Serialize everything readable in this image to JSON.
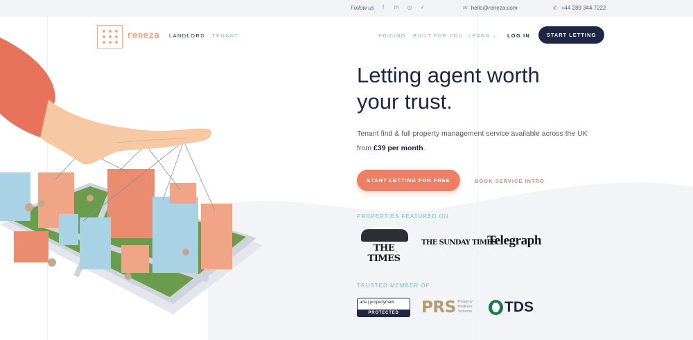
{
  "topbar": {
    "follow_label": "Follow us",
    "social_icons": [
      "facebook-icon",
      "linkedin-icon",
      "instagram-icon",
      "twitter-icon"
    ],
    "email": "hello@reneza.com",
    "phone": "+44 289 344 7222"
  },
  "header": {
    "brand": "reneza",
    "nav_left": [
      "LANDLORD",
      "TENANT"
    ],
    "nav_right": {
      "pricing": "PRICING",
      "built_for_you": "BUILT FOR YOU",
      "learn": "LEARN",
      "login": "LOG IN"
    },
    "cta": "START LETTING"
  },
  "hero": {
    "headline_line1": "Letting agent worth",
    "headline_line2": "your trust.",
    "subtext_line1": "Tenant find & full property management service available across the UK",
    "subtext_from": "from",
    "subtext_price": "£39 per month",
    "subtext_end": ".",
    "primary_cta": "START LETTING FOR FREE",
    "secondary_cta": "BOOK SERVICE INTRO"
  },
  "featured": {
    "label": "PROPERTIES FEATURED ON",
    "logos": [
      "THE TIMES",
      "THE SUNDAY TIMES",
      "Telegraph"
    ]
  },
  "trusted": {
    "label": "TRUSTED MEMBER OF",
    "arla_top": "arla | propertymark",
    "arla_bottom": "PROTECTED",
    "prs": "PRS",
    "prs_sub_line1": "Property",
    "prs_sub_line2": "Redress",
    "prs_sub_line3": "Scheme",
    "tds": "TDS"
  },
  "colors": {
    "navy": "#1d2745",
    "coral": "#ef7f64",
    "teal": "#6fc2c9",
    "logo_peach": "#f1a58c"
  }
}
